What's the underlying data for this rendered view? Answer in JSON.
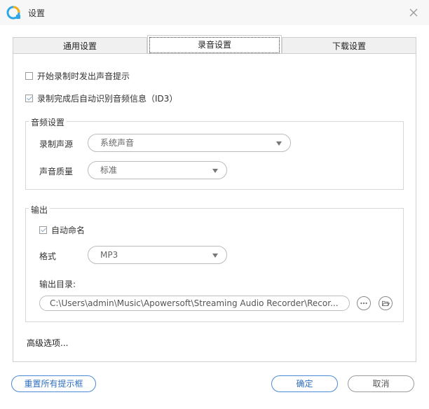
{
  "window": {
    "title": "设置",
    "app_icon": "app-logo-icon",
    "close_icon": "close-icon"
  },
  "tabs": [
    {
      "label": "通用设置",
      "active": false
    },
    {
      "label": "录音设置",
      "active": true
    },
    {
      "label": "下载设置",
      "active": false
    }
  ],
  "options": {
    "start_prompt": {
      "label": "开始录制时发出声音提示",
      "checked": false
    },
    "id3_auto": {
      "label": "录制完成后自动识别音频信息（ID3）",
      "checked": true
    }
  },
  "audio_settings": {
    "title": "音频设置",
    "source_label": "录制声源",
    "source_value": "系统声音",
    "quality_label": "声音质量",
    "quality_value": "标准"
  },
  "output": {
    "title": "输出",
    "auto_name": {
      "label": "自动命名",
      "checked": true
    },
    "format_label": "格式",
    "format_value": "MP3",
    "dir_label": "输出目录:",
    "dir_value": "C:\\Users\\admin\\Music\\Apowersoft\\Streaming Audio Recorder\\Recor...",
    "more_icon": "ellipsis-icon",
    "folder_icon": "folder-open-icon"
  },
  "advanced_label": "高级选项...",
  "footer": {
    "reset_label": "重置所有提示框",
    "ok_label": "确定",
    "cancel_label": "取消"
  },
  "colors": {
    "accent": "#4a8ad4",
    "titlebar_bg": "#f7f7f7",
    "border": "#cfcfcf"
  }
}
